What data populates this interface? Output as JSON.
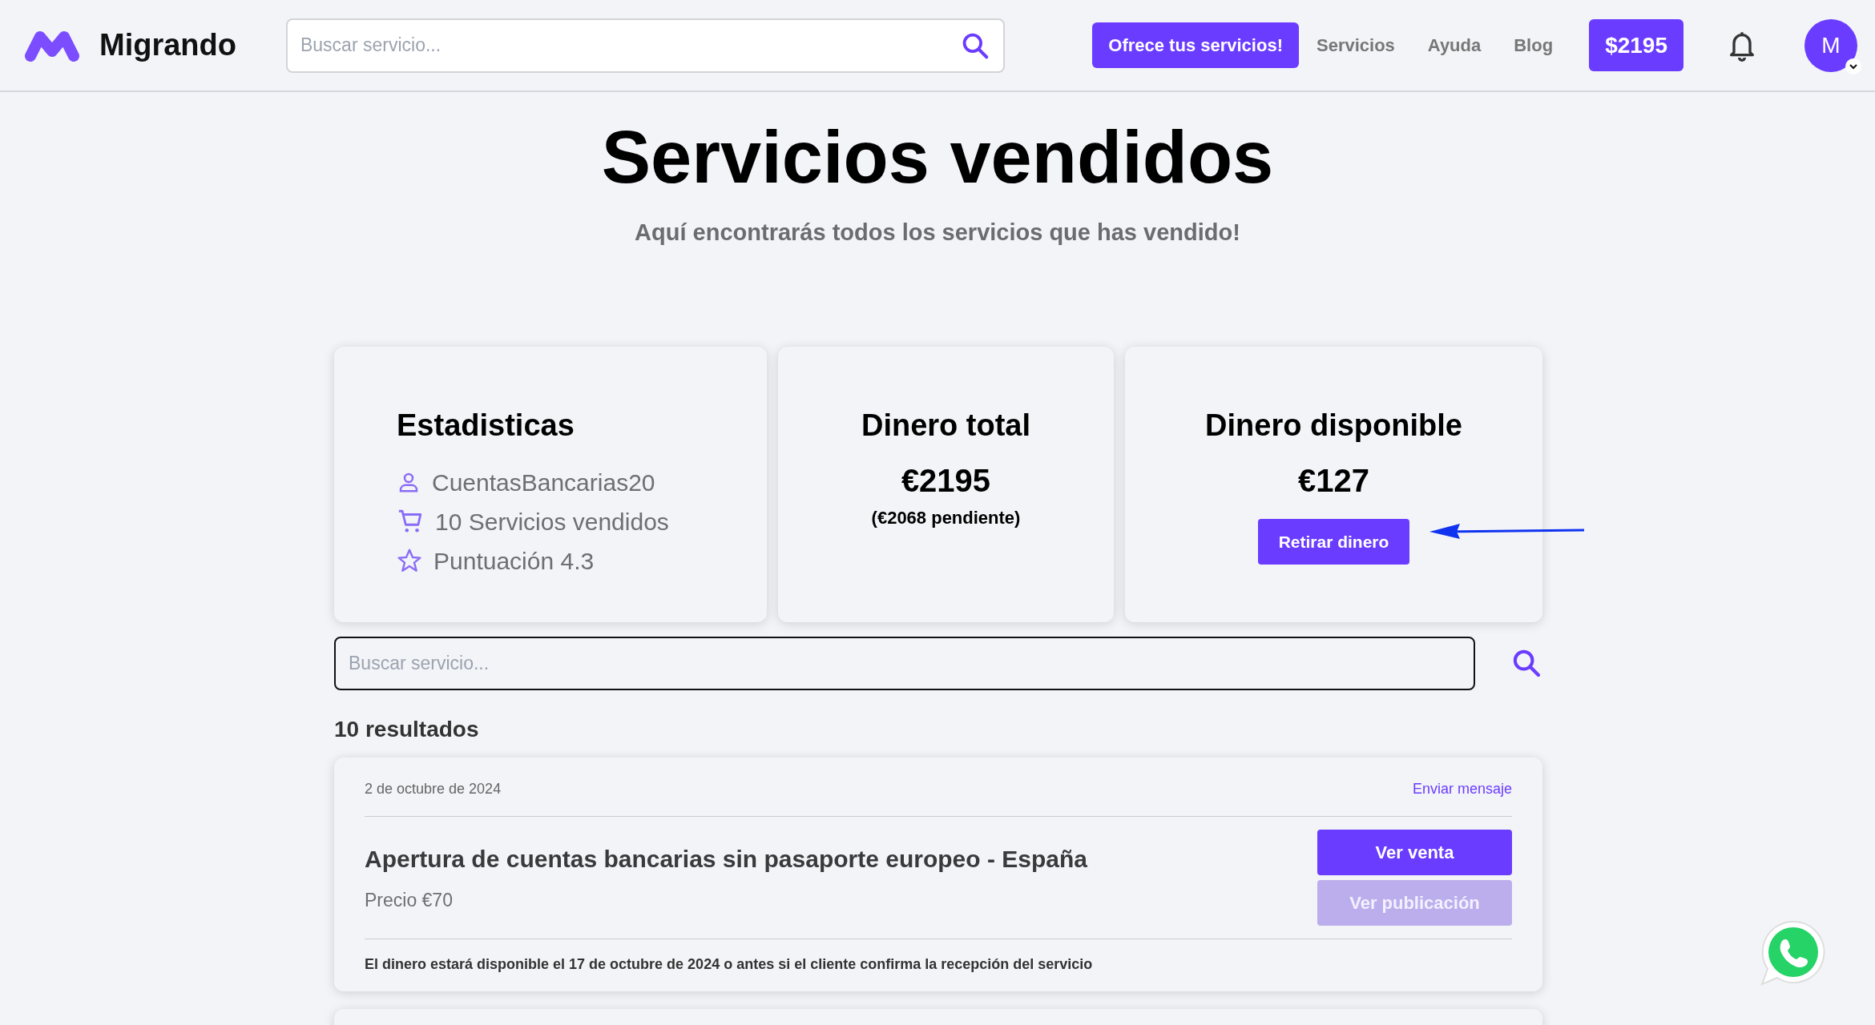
{
  "header": {
    "brand": "Migrando",
    "search": {
      "placeholder": "Buscar servicio..."
    },
    "cta": "Ofrece tus servicios!",
    "nav": [
      "Servicios",
      "Ayuda",
      "Blog"
    ],
    "balance": "$2195",
    "avatar": "M"
  },
  "page": {
    "title": "Servicios vendidos",
    "subtitle": "Aquí encontrarás todos los servicios que has vendido!"
  },
  "stats": {
    "title": "Estadisticas",
    "items": [
      {
        "kind": "user",
        "text": "CuentasBancarias20"
      },
      {
        "kind": "cart",
        "text": "10 Servicios vendidos"
      },
      {
        "kind": "star",
        "text": "Puntuación 4.3"
      }
    ]
  },
  "total": {
    "title": "Dinero total",
    "amount": "€2195",
    "pending": "(€2068 pendiente)"
  },
  "available": {
    "title": "Dinero disponible",
    "amount": "€127",
    "button": "Retirar dinero"
  },
  "search": {
    "placeholder": "Buscar servicio..."
  },
  "results": "10 resultados",
  "sales": [
    {
      "date": "2 de octubre de 2024",
      "link": "Enviar mensaje",
      "title": "Apertura de cuentas bancarias sin pasaporte europeo - España",
      "price": "Precio €70",
      "buttons": [
        {
          "label": "Ver venta",
          "disabled": false
        },
        {
          "label": "Ver publicación",
          "disabled": true
        }
      ],
      "note": "El dinero estará disponible el 17 de octubre de 2024 o antes si el cliente confirma la recepción del servicio"
    }
  ]
}
